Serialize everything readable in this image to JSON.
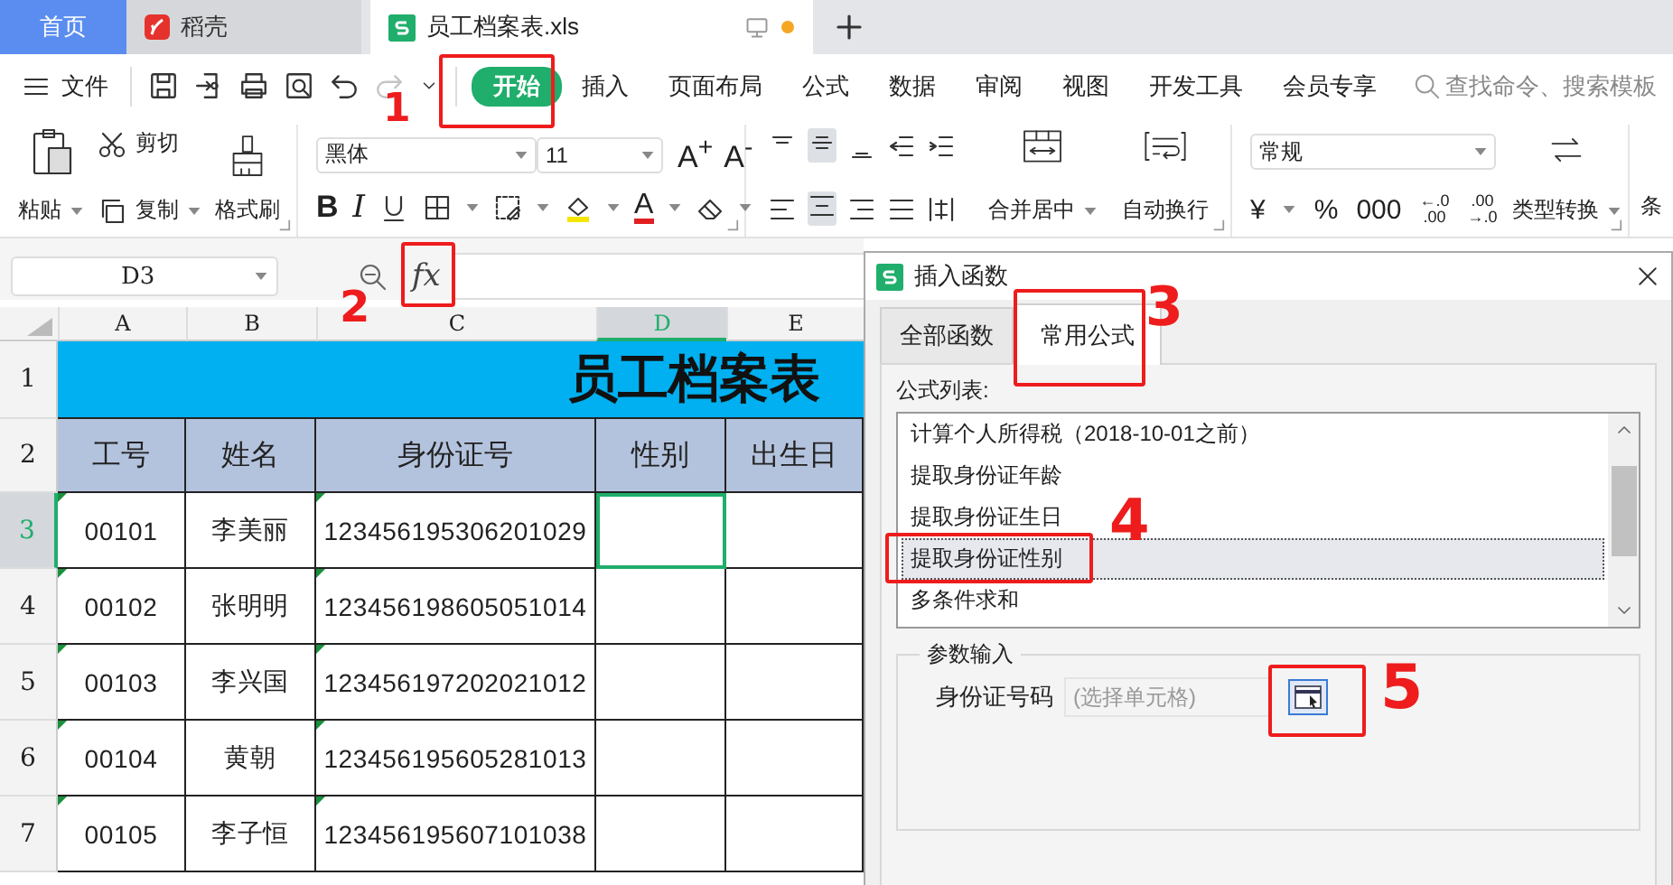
{
  "browser_tabs": [
    {
      "label": "首页",
      "kind": "home",
      "selected": false
    },
    {
      "label": "稻壳",
      "kind": "docer",
      "selected": false
    },
    {
      "label": "员工档案表.xls",
      "kind": "sheet",
      "selected": true
    }
  ],
  "menu": {
    "file": "文件",
    "quick_access": [
      {
        "kind": "save",
        "disabled": false
      },
      {
        "kind": "export",
        "disabled": false
      },
      {
        "kind": "print",
        "disabled": false
      },
      {
        "kind": "preview",
        "disabled": false
      },
      {
        "kind": "undo",
        "disabled": false
      },
      {
        "kind": "redo",
        "disabled": true
      },
      {
        "kind": "more",
        "disabled": false
      }
    ],
    "tabs": [
      {
        "label": "开始",
        "selected": true
      },
      {
        "label": "插入",
        "selected": false
      },
      {
        "label": "页面布局",
        "selected": false
      },
      {
        "label": "公式",
        "selected": false
      },
      {
        "label": "数据",
        "selected": false
      },
      {
        "label": "审阅",
        "selected": false
      },
      {
        "label": "视图",
        "selected": false
      },
      {
        "label": "开发工具",
        "selected": false
      },
      {
        "label": "会员专享",
        "selected": false
      }
    ],
    "search_placeholder": "查找命令、搜索模板"
  },
  "ribbon": {
    "paste": "粘贴",
    "cut": "剪切",
    "copy": "复制",
    "format_painter": "格式刷",
    "font": "黑体",
    "size": "11",
    "grow_font": "A$^{+}$",
    "shrink_font": "A$^{-}$",
    "bold": "B",
    "italic": "I",
    "font_color": "A",
    "merge": "合并居中",
    "wrap": "自动换行",
    "number_format": "常规",
    "number_tools": [
      {
        "kind": "plain",
        "label": "¥"
      },
      {
        "kind": "plain",
        "label": "%"
      },
      {
        "kind": "plain",
        "label": "000"
      },
      {
        "kind": "stack",
        "top": "←.0",
        "bottom": ".00"
      },
      {
        "kind": "stack",
        "top": ".00",
        "bottom": "→.0"
      }
    ],
    "convert": "类型转换",
    "next_group": "条"
  },
  "formula_bar": {
    "cell": "D3",
    "fx": "fx"
  },
  "sheet": {
    "columns": [
      {
        "label": "A",
        "selected": false
      },
      {
        "label": "B",
        "selected": false
      },
      {
        "label": "C",
        "selected": false
      },
      {
        "label": "D",
        "selected": true
      },
      {
        "label": "E",
        "selected": false
      }
    ],
    "rows": [
      {
        "label": "1",
        "selected": false
      },
      {
        "label": "2",
        "selected": false
      },
      {
        "label": "3",
        "selected": true
      },
      {
        "label": "4",
        "selected": false
      },
      {
        "label": "5",
        "selected": false
      },
      {
        "label": "6",
        "selected": false
      },
      {
        "label": "7",
        "selected": false
      }
    ],
    "title": "员工档案表",
    "headers": [
      "工号",
      "姓名",
      "身份证号",
      "性别",
      "出生日"
    ],
    "records": [
      {
        "id": "00101",
        "name": "李美丽",
        "id_number": "123456195306201029"
      },
      {
        "id": "00102",
        "name": "张明明",
        "id_number": "123456198605051014"
      },
      {
        "id": "00103",
        "name": "李兴国",
        "id_number": "123456197202021012"
      },
      {
        "id": "00104",
        "name": "黄朝",
        "id_number": "123456195605281013"
      },
      {
        "id": "00105",
        "name": "李子恒",
        "id_number": "123456195607101038"
      }
    ]
  },
  "dialog": {
    "title": "插入函数",
    "tabs": [
      {
        "label": "全部函数",
        "selected": false
      },
      {
        "label": "常用公式",
        "selected": true
      }
    ],
    "list_label": "公式列表:",
    "formulas": [
      {
        "label": "计算个人所得税（2018-10-01之前）",
        "selected": false
      },
      {
        "label": "提取身份证年龄",
        "selected": false
      },
      {
        "label": "提取身份证生日",
        "selected": false
      },
      {
        "label": "提取身份证性别",
        "selected": true
      },
      {
        "label": "多条件求和",
        "selected": false
      }
    ],
    "params_label": "参数输入",
    "param": {
      "label": "身份证号码",
      "placeholder": "(选择单元格)"
    }
  },
  "annotations": [
    {
      "label": "1"
    },
    {
      "label": "2"
    },
    {
      "label": "3"
    },
    {
      "label": "4"
    },
    {
      "label": "5"
    }
  ]
}
